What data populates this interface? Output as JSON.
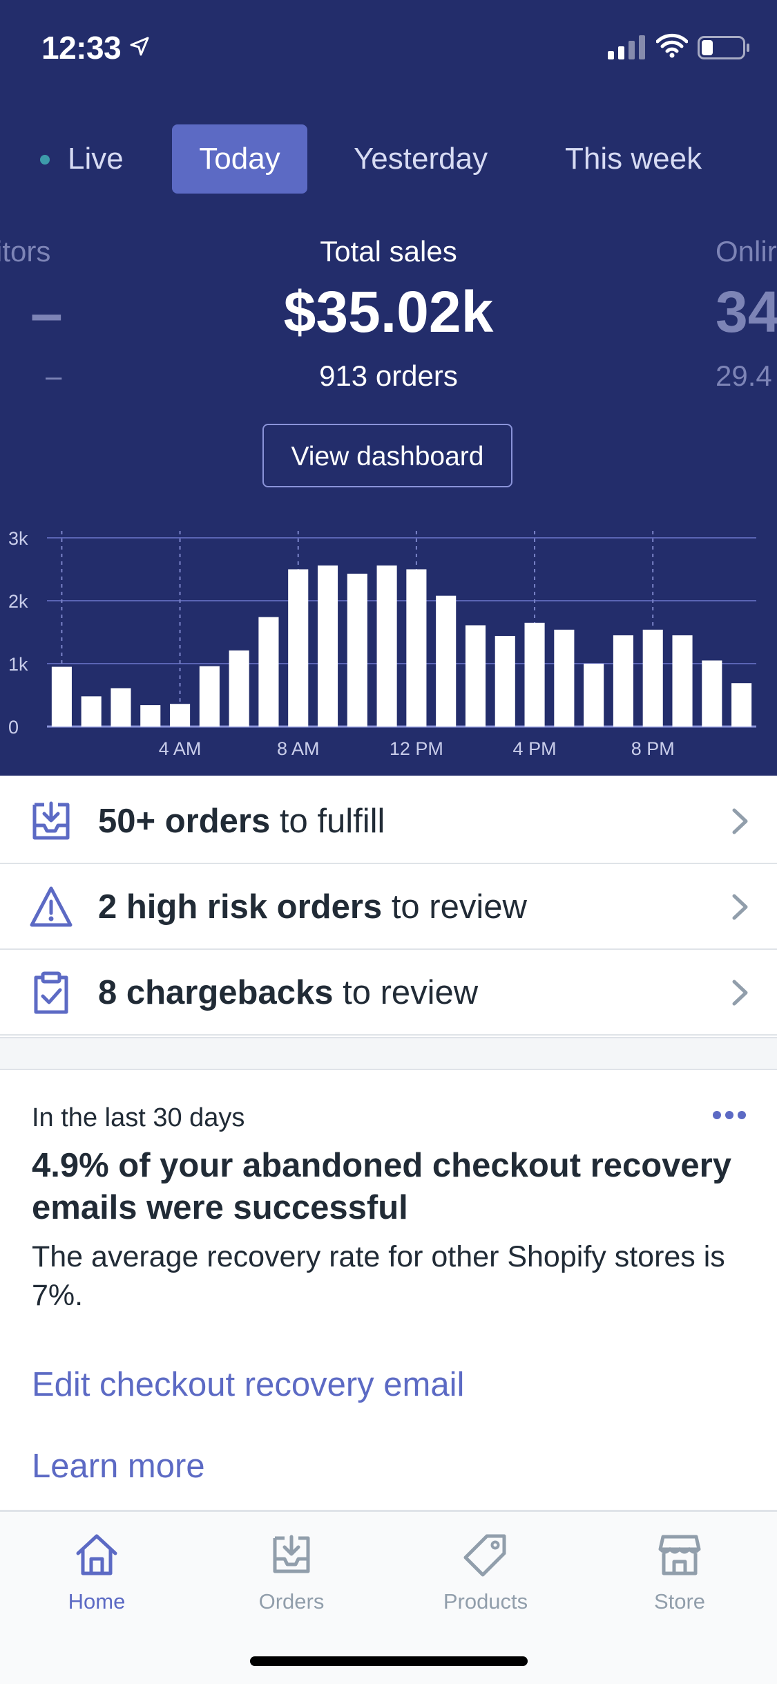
{
  "status_bar": {
    "time": "12:33",
    "icons": [
      "location-arrow-icon",
      "cellular-signal-icon",
      "wifi-icon",
      "battery-icon"
    ]
  },
  "range_tabs": [
    {
      "label": "Live",
      "active": false
    },
    {
      "label": "Today",
      "active": true
    },
    {
      "label": "Yesterday",
      "active": false
    },
    {
      "label": "This week",
      "active": false
    }
  ],
  "metrics": {
    "left_partial": {
      "label": "itors",
      "value": "–",
      "sub": "–"
    },
    "center": {
      "label": "Total sales",
      "value": "$35.02k",
      "sub": "913 orders"
    },
    "right_partial": {
      "label": "Onlir",
      "value": "34",
      "sub": "29.4"
    }
  },
  "view_dashboard_label": "View dashboard",
  "chart_data": {
    "type": "bar",
    "categories": [
      "12 AM",
      "1 AM",
      "2 AM",
      "3 AM",
      "4 AM",
      "5 AM",
      "6 AM",
      "7 AM",
      "8 AM",
      "9 AM",
      "10 AM",
      "11 AM",
      "12 PM",
      "1 PM",
      "2 PM",
      "3 PM",
      "4 PM",
      "5 PM",
      "6 PM",
      "7 PM",
      "8 PM",
      "9 PM",
      "10 PM",
      "11 PM"
    ],
    "x_tick_labels": [
      "4 AM",
      "8 AM",
      "12 PM",
      "4 PM",
      "8 PM"
    ],
    "values": [
      950,
      480,
      610,
      340,
      360,
      960,
      1210,
      1740,
      2500,
      2560,
      2430,
      2560,
      2500,
      2080,
      1610,
      1440,
      1650,
      1540,
      1000,
      1450,
      1540,
      1450,
      1050,
      690
    ],
    "y_tick_labels": [
      "0",
      "1k",
      "2k",
      "3k"
    ],
    "ylim": [
      0,
      3000
    ],
    "grid": true
  },
  "tasks": [
    {
      "icon": "inbox-download-icon",
      "bold": "50+ orders",
      "rest": " to fulfill"
    },
    {
      "icon": "warning-triangle-icon",
      "bold": "2 high risk orders",
      "rest": " to review"
    },
    {
      "icon": "clipboard-check-icon",
      "bold": "8 chargebacks",
      "rest": " to review"
    }
  ],
  "insight": {
    "eyebrow": "In the last 30 days",
    "title": "4.9% of your abandoned checkout recovery emails were successful",
    "body": "The average recovery rate for other Shopify stores is 7%.",
    "link_primary": "Edit checkout recovery email",
    "link_secondary": "Learn more"
  },
  "tabbar": [
    {
      "label": "Home",
      "icon": "home-icon",
      "active": true
    },
    {
      "label": "Orders",
      "icon": "orders-inbox-icon",
      "active": false
    },
    {
      "label": "Products",
      "icon": "tag-icon",
      "active": false
    },
    {
      "label": "Store",
      "icon": "storefront-icon",
      "active": false
    }
  ],
  "colors": {
    "hero_bg": "#232d6b",
    "accent": "#5c6ac4",
    "text": "#212b36",
    "muted": "#919eab"
  }
}
